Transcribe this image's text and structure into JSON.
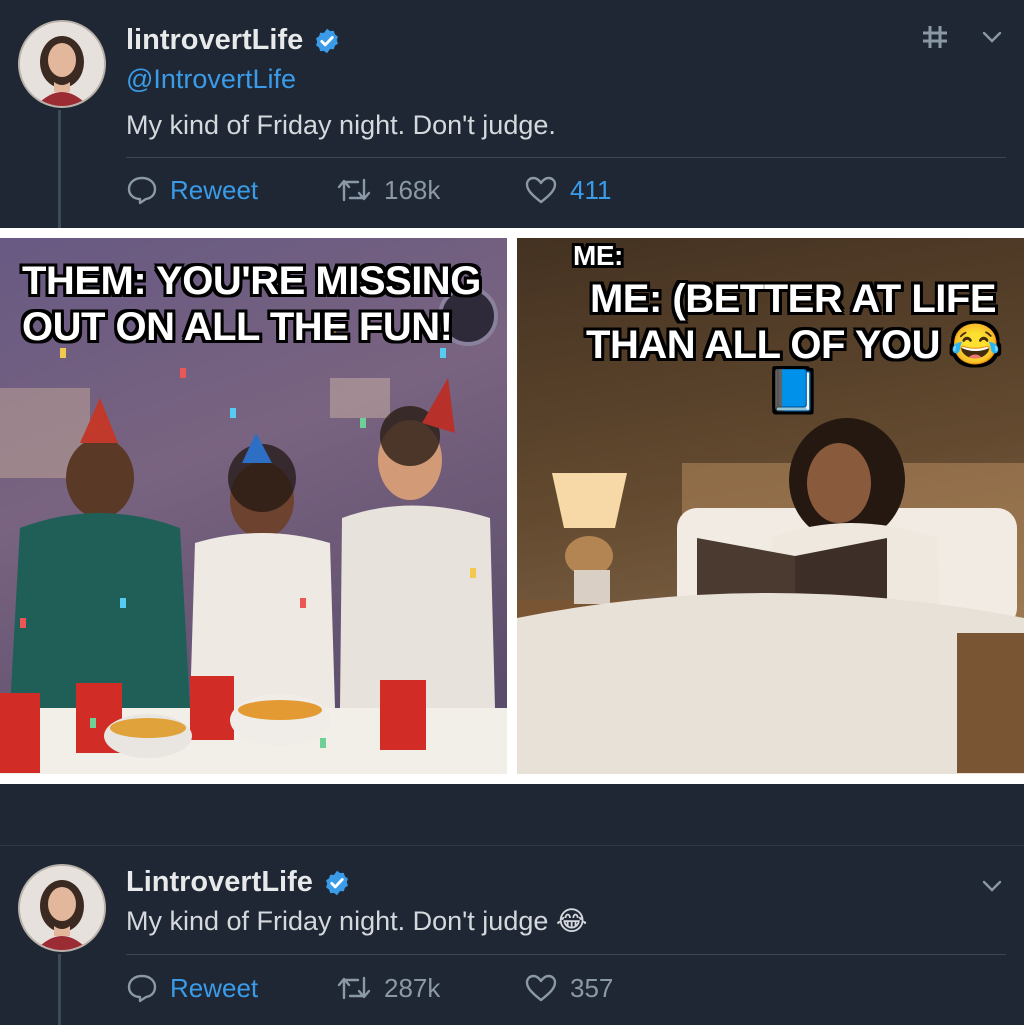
{
  "tweet_top": {
    "display_name": "lintrovertLife",
    "handle": "@IntrovertLife",
    "text": "My kind of Friday night. Don't judge.",
    "actions": {
      "reweet_label": "Reweet",
      "retweet_count": "168k",
      "like_count": "411"
    }
  },
  "media": {
    "left_caption": "THEM: YOU'RE MISSING OUT ON ALL THE FUN!",
    "right_caption_small": "ME:",
    "right_caption_line1": "ME: (BETTER AT LIFE",
    "right_caption_line2": "THAN ALL OF YOU 😂📘"
  },
  "tweet_bottom": {
    "display_name": "LintrovertLife",
    "text": "My kind of Friday night. Don't judge 😂",
    "actions": {
      "reweet_label": "Reweet",
      "retweet_count": "287k",
      "like_count": "357"
    }
  },
  "colors": {
    "background": "#1e2733",
    "accent_blue": "#3a9be8",
    "muted": "#8b98a5"
  },
  "icons": [
    "verified-badge-icon",
    "hashtag-icon",
    "chevron-down-icon",
    "reply-icon",
    "retweet-icon",
    "heart-icon"
  ]
}
